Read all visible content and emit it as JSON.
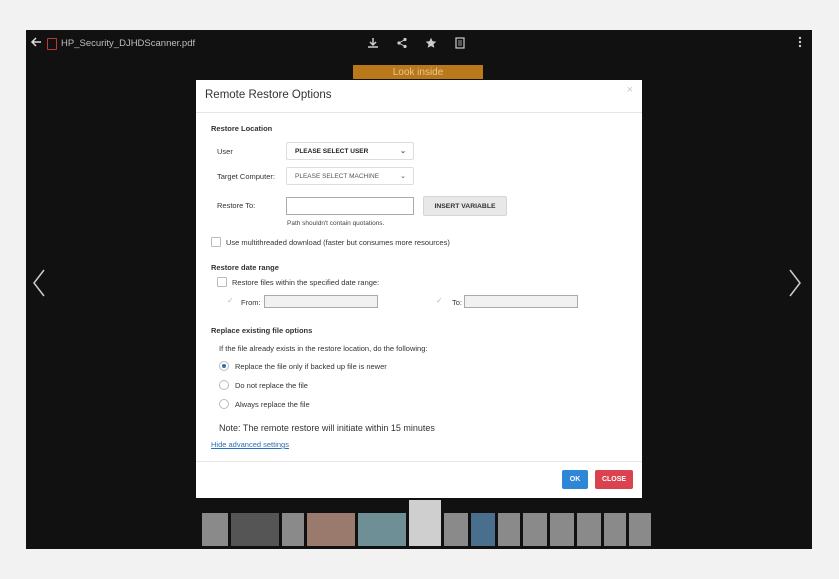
{
  "viewer": {
    "file_name": "HP_Security_DJHDScanner.pdf",
    "look_inside": "Look inside",
    "icons": [
      "back-arrow-icon",
      "pdf-file-icon",
      "download-icon",
      "share-icon",
      "star-icon",
      "document-icon",
      "more-vertical-icon",
      "chevron-left-icon",
      "chevron-right-icon"
    ]
  },
  "modal": {
    "title": "Remote Restore Options",
    "close_glyph": "×",
    "restore_location": {
      "heading": "Restore Location",
      "user_label": "User",
      "user_value": "PLEASE SELECT USER",
      "target_label": "Target Computer:",
      "target_value": "PLEASE SELECT MACHINE",
      "restore_to_label": "Restore To:",
      "restore_to_value": "",
      "insert_variable": "INSERT VARIABLE",
      "path_hint": "Path shouldn't contain quotations.",
      "multithread_label": "Use multithreaded download (faster but consumes more resources)"
    },
    "date_range": {
      "heading": "Restore date range",
      "checkbox_label": "Restore files within the specified date range:",
      "from_label": "From:",
      "to_label": "To:"
    },
    "replace": {
      "heading": "Replace existing file options",
      "intro": "If the file already exists in the restore location, do the following:",
      "options": [
        "Replace the file only if backed up file is newer",
        "Do not replace the file",
        "Always replace the file"
      ],
      "selected_index": 0
    },
    "note": "Note: The remote restore will initiate within 15 minutes",
    "advanced_link": "Hide advanced settings",
    "ok": "OK",
    "close": "CLOSE"
  },
  "colors": {
    "ok": "#2e86d6",
    "close": "#d9424e",
    "link": "#2a6ebb",
    "look_inside": "#b9781a"
  }
}
